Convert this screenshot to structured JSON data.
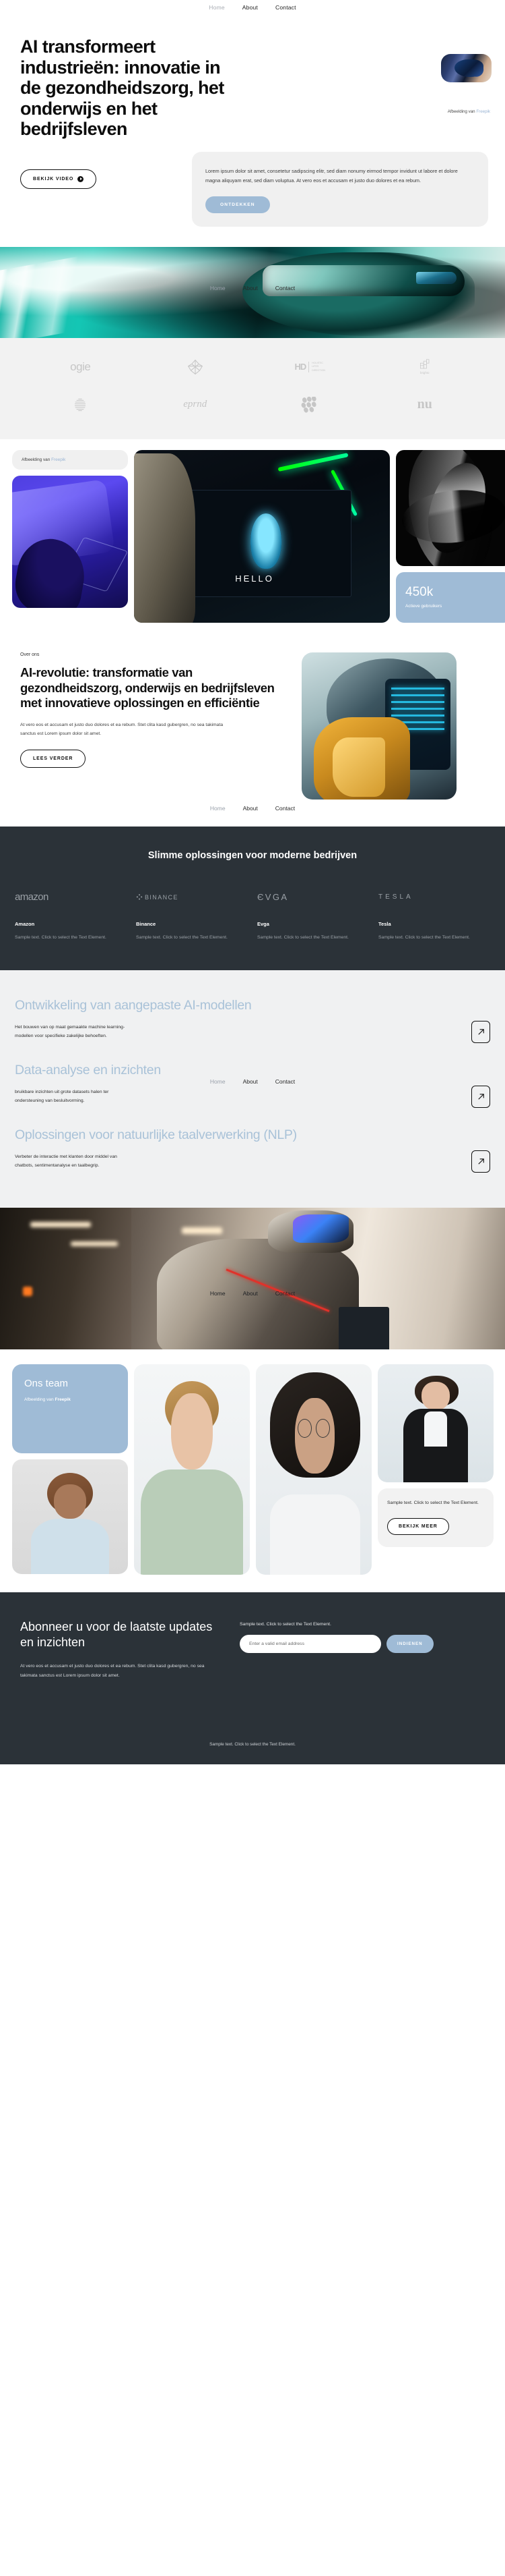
{
  "nav": {
    "items": [
      {
        "label": "Home",
        "active": true
      },
      {
        "label": "About",
        "active": false
      },
      {
        "label": "Contact",
        "active": false
      }
    ]
  },
  "hero": {
    "title": "AI transformeert industrieën: innovatie in de gezondheidszorg, het onderwijs en het bedrijfsleven",
    "credit_prefix": "Afbeelding van ",
    "credit_link": "Freepik",
    "video_button": "BEKIJK VIDEO",
    "paragraph": "Lorem ipsum dolor sit amet, consetetur sadipscing elitr, sed diam nonumy eirmod tempor invidunt ut labore et dolore magna aliquyam erat, sed diam voluptua. At vero eos et accusam et justo duo dolores et ea rebum.",
    "cta_button": "ONTDEKKEN"
  },
  "logos": {
    "row1": [
      "ogie",
      "flower-mark",
      "HD HOLISTIC LIFES DIRECTION",
      "brighto"
    ],
    "row2": [
      "striped-sphere",
      "eprnd",
      "dots-mark",
      "nu"
    ]
  },
  "gallery": {
    "credit_prefix": "Afbeelding van ",
    "credit_link": "Freepik",
    "screen_text": "HELLO",
    "stat_number": "450k",
    "stat_label": "Actieve gebruikers"
  },
  "about": {
    "eyebrow": "Over ons",
    "title": "AI-revolutie: transformatie van gezondheidszorg, onderwijs en bedrijfsleven met innovatieve oplossingen en efficiëntie",
    "body": "At vero eos et accusam et justo duo dolores et ea rebum. Stet clita kasd gubergren, no sea takimata sanctus est Lorem ipsum dolor sit amet.",
    "button": "LEES VERDER"
  },
  "partners": {
    "title": "Slimme oplossingen voor moderne bedrijven",
    "items": [
      {
        "logo": "amazon",
        "name": "Amazon",
        "desc": "Sample text. Click to select the Text Element."
      },
      {
        "logo": "binance",
        "name": "Binance",
        "desc": "Sample text. Click to select the Text Element."
      },
      {
        "logo": "evga",
        "name": "Evga",
        "desc": "Sample text. Click to select the Text Element."
      },
      {
        "logo": "tesla",
        "name": "Tesla",
        "desc": "Sample text. Click to select the Text Element."
      }
    ]
  },
  "services": {
    "items": [
      {
        "title": "Ontwikkeling van aangepaste AI-modellen",
        "desc": "Het bouwen van op maat gemaakte machine learning-modellen voor specifieke zakelijke behoeften."
      },
      {
        "title": "Data-analyse en inzichten",
        "desc": "bruikbare inzichten uit grote datasets halen ter ondersteuning van besluitvorming."
      },
      {
        "title": "Oplossingen voor natuurlijke taalverwerking (NLP)",
        "desc": "Verbeter de interactie met klanten door middel van chatbots, sentimentanalyse en taalbegrip."
      }
    ],
    "arrow_icon": "arrow-up-right-icon"
  },
  "team": {
    "title": "Ons team",
    "credit_prefix": "Afbeelding van ",
    "credit_link": "Freepik",
    "card_text": "Sample text. Click to select the Text Element.",
    "card_button": "BEKIJK MEER"
  },
  "footer": {
    "title": "Abonneer u voor de laatste updates en inzichten",
    "body": "At vero eos et accusam et justo duo dolores et ea rebum. Stet clita kasd gubergren, no sea takimata sanctus est Lorem ipsum dolor sit amet.",
    "note": "Sample text. Click to select the Text Element.",
    "email_placeholder": "Enter a valid email address",
    "submit_label": "INDIENEN",
    "bottom_text": "Sample text. Click to select the Text Element."
  },
  "colors": {
    "accent": "#9fbbd6",
    "dark": "#2b3238",
    "light_bg": "#f0f1f2",
    "heading": "#0d0d0d",
    "service_title": "#a9c2d8"
  }
}
